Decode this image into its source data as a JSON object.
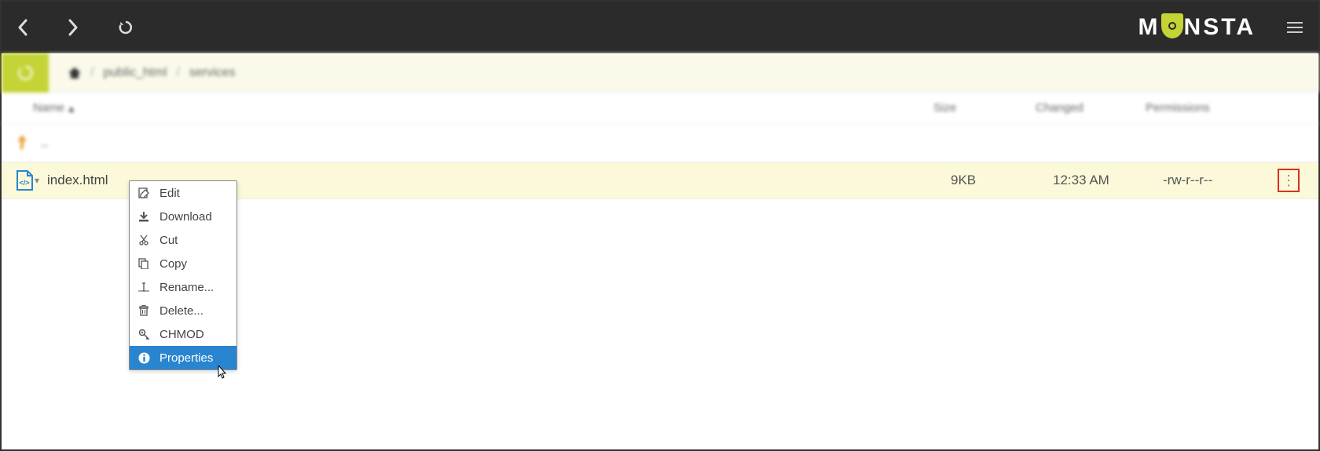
{
  "logo": {
    "prefix": "M",
    "shield": "O",
    "suffix": "NSTA"
  },
  "breadcrumb": {
    "seg1": "public_html",
    "seg2": "services"
  },
  "headers": {
    "name": "Name",
    "size": "Size",
    "changed": "Changed",
    "permissions": "Permissions"
  },
  "parent_row": {
    "label": ".."
  },
  "file_row": {
    "name": "index.html",
    "size": "9KB",
    "changed": "12:33 AM",
    "permissions": "-rw-r--r--"
  },
  "context_menu": {
    "edit": "Edit",
    "download": "Download",
    "cut": "Cut",
    "copy": "Copy",
    "rename": "Rename...",
    "delete": "Delete...",
    "chmod": "CHMOD",
    "properties": "Properties"
  }
}
